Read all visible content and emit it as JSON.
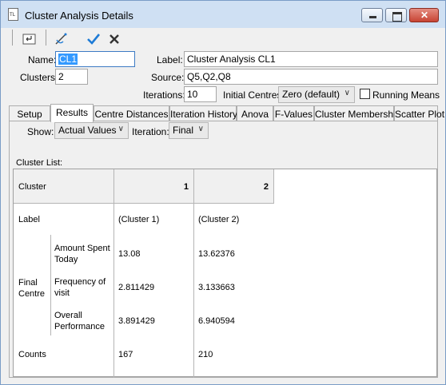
{
  "window": {
    "title": "Cluster Analysis Details",
    "icon": "document-icon"
  },
  "toolbar": {
    "icons": [
      "exit-icon",
      "notes-icon",
      "check-icon",
      "cancel-icon"
    ],
    "accent": "#1e7bd6"
  },
  "form": {
    "name_label": "Name:",
    "name_value": "CL1",
    "clusters_label": "Clusters:",
    "clusters_value": "2",
    "label_label": "Label:",
    "label_value": "Cluster Analysis CL1",
    "source_label": "Source:",
    "source_value": "Q5,Q2,Q8",
    "iterations_label": "Iterations:",
    "iterations_value": "10",
    "initial_label": "Initial Centres:",
    "initial_value": "Zero (default)",
    "running_means_label": "Running Means",
    "running_means_checked": false
  },
  "tabs": [
    {
      "label": "Setup"
    },
    {
      "label": "Results"
    },
    {
      "label": "Centre Distances"
    },
    {
      "label": "Iteration History"
    },
    {
      "label": "Anova"
    },
    {
      "label": "F-Values"
    },
    {
      "label": "Cluster Membership"
    },
    {
      "label": "Scatter Plot"
    }
  ],
  "results": {
    "show_label": "Show:",
    "show_value": "Actual Values",
    "iteration_label": "Iteration:",
    "iteration_value": "Final",
    "cluster_list_label": "Cluster List:",
    "table": {
      "header": "Cluster",
      "columns": [
        "1",
        "2"
      ],
      "label_row": {
        "name": "Label",
        "values": [
          "(Cluster 1)",
          "(Cluster 2)"
        ]
      },
      "group": "Final\nCentre",
      "group_line1": "Final",
      "group_line2": "Centre",
      "variables": [
        {
          "line1": "Amount Spent",
          "line2": "Today",
          "values": [
            "13.08",
            "13.62376"
          ]
        },
        {
          "line1": "Frequency of",
          "line2": "visit",
          "values": [
            "2.811429",
            "3.133663"
          ]
        },
        {
          "line1": "Overall",
          "line2": "Performance",
          "values": [
            "3.891429",
            "6.940594"
          ]
        }
      ],
      "counts_row": {
        "name": "Counts",
        "values": [
          "167",
          "210"
        ]
      }
    }
  }
}
